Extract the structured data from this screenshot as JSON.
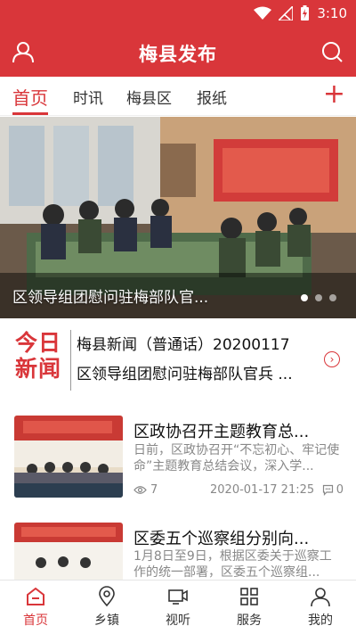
{
  "status_bar": {
    "time": "3:10"
  },
  "app_bar": {
    "title": "梅县发布"
  },
  "tabs": [
    {
      "label": "首页",
      "active": true
    },
    {
      "label": "时讯",
      "active": false
    },
    {
      "label": "梅县区",
      "active": false
    },
    {
      "label": "报纸",
      "active": false
    }
  ],
  "tabs_add": "+",
  "banner": {
    "caption": "区领导组团慰问驻梅部队官...",
    "dots_total": 3,
    "dot_active": 1
  },
  "today": {
    "logo_line1": "今日",
    "logo_line2": "新闻",
    "headline": "梅县新闻（普通话）20200117",
    "subheadline": "区领导组团慰问驻梅部队官兵 ..."
  },
  "news": [
    {
      "title": "区政协召开主题教育总...",
      "summary": "日前，区政协召开“不忘初心、牢记使命”主题教育总结会议，深入学...",
      "views": "7",
      "date": "2020-01-17 21:25",
      "comments": "0"
    },
    {
      "title": "区委五个巡察组分别向...",
      "summary": "1月8日至9日，根据区委关于巡察工作的统一部署，区委五个巡察组..."
    }
  ],
  "bottom_nav": [
    {
      "label": "首页",
      "icon": "home-icon",
      "active": true
    },
    {
      "label": "乡镇",
      "icon": "location-pin-icon",
      "active": false
    },
    {
      "label": "视听",
      "icon": "video-icon",
      "active": false
    },
    {
      "label": "服务",
      "icon": "grid-icon",
      "active": false
    },
    {
      "label": "我的",
      "icon": "user-icon",
      "active": false
    }
  ],
  "colors": {
    "brand_red": "#d9363a",
    "text_dark": "#111111",
    "text_gray": "#888888"
  }
}
